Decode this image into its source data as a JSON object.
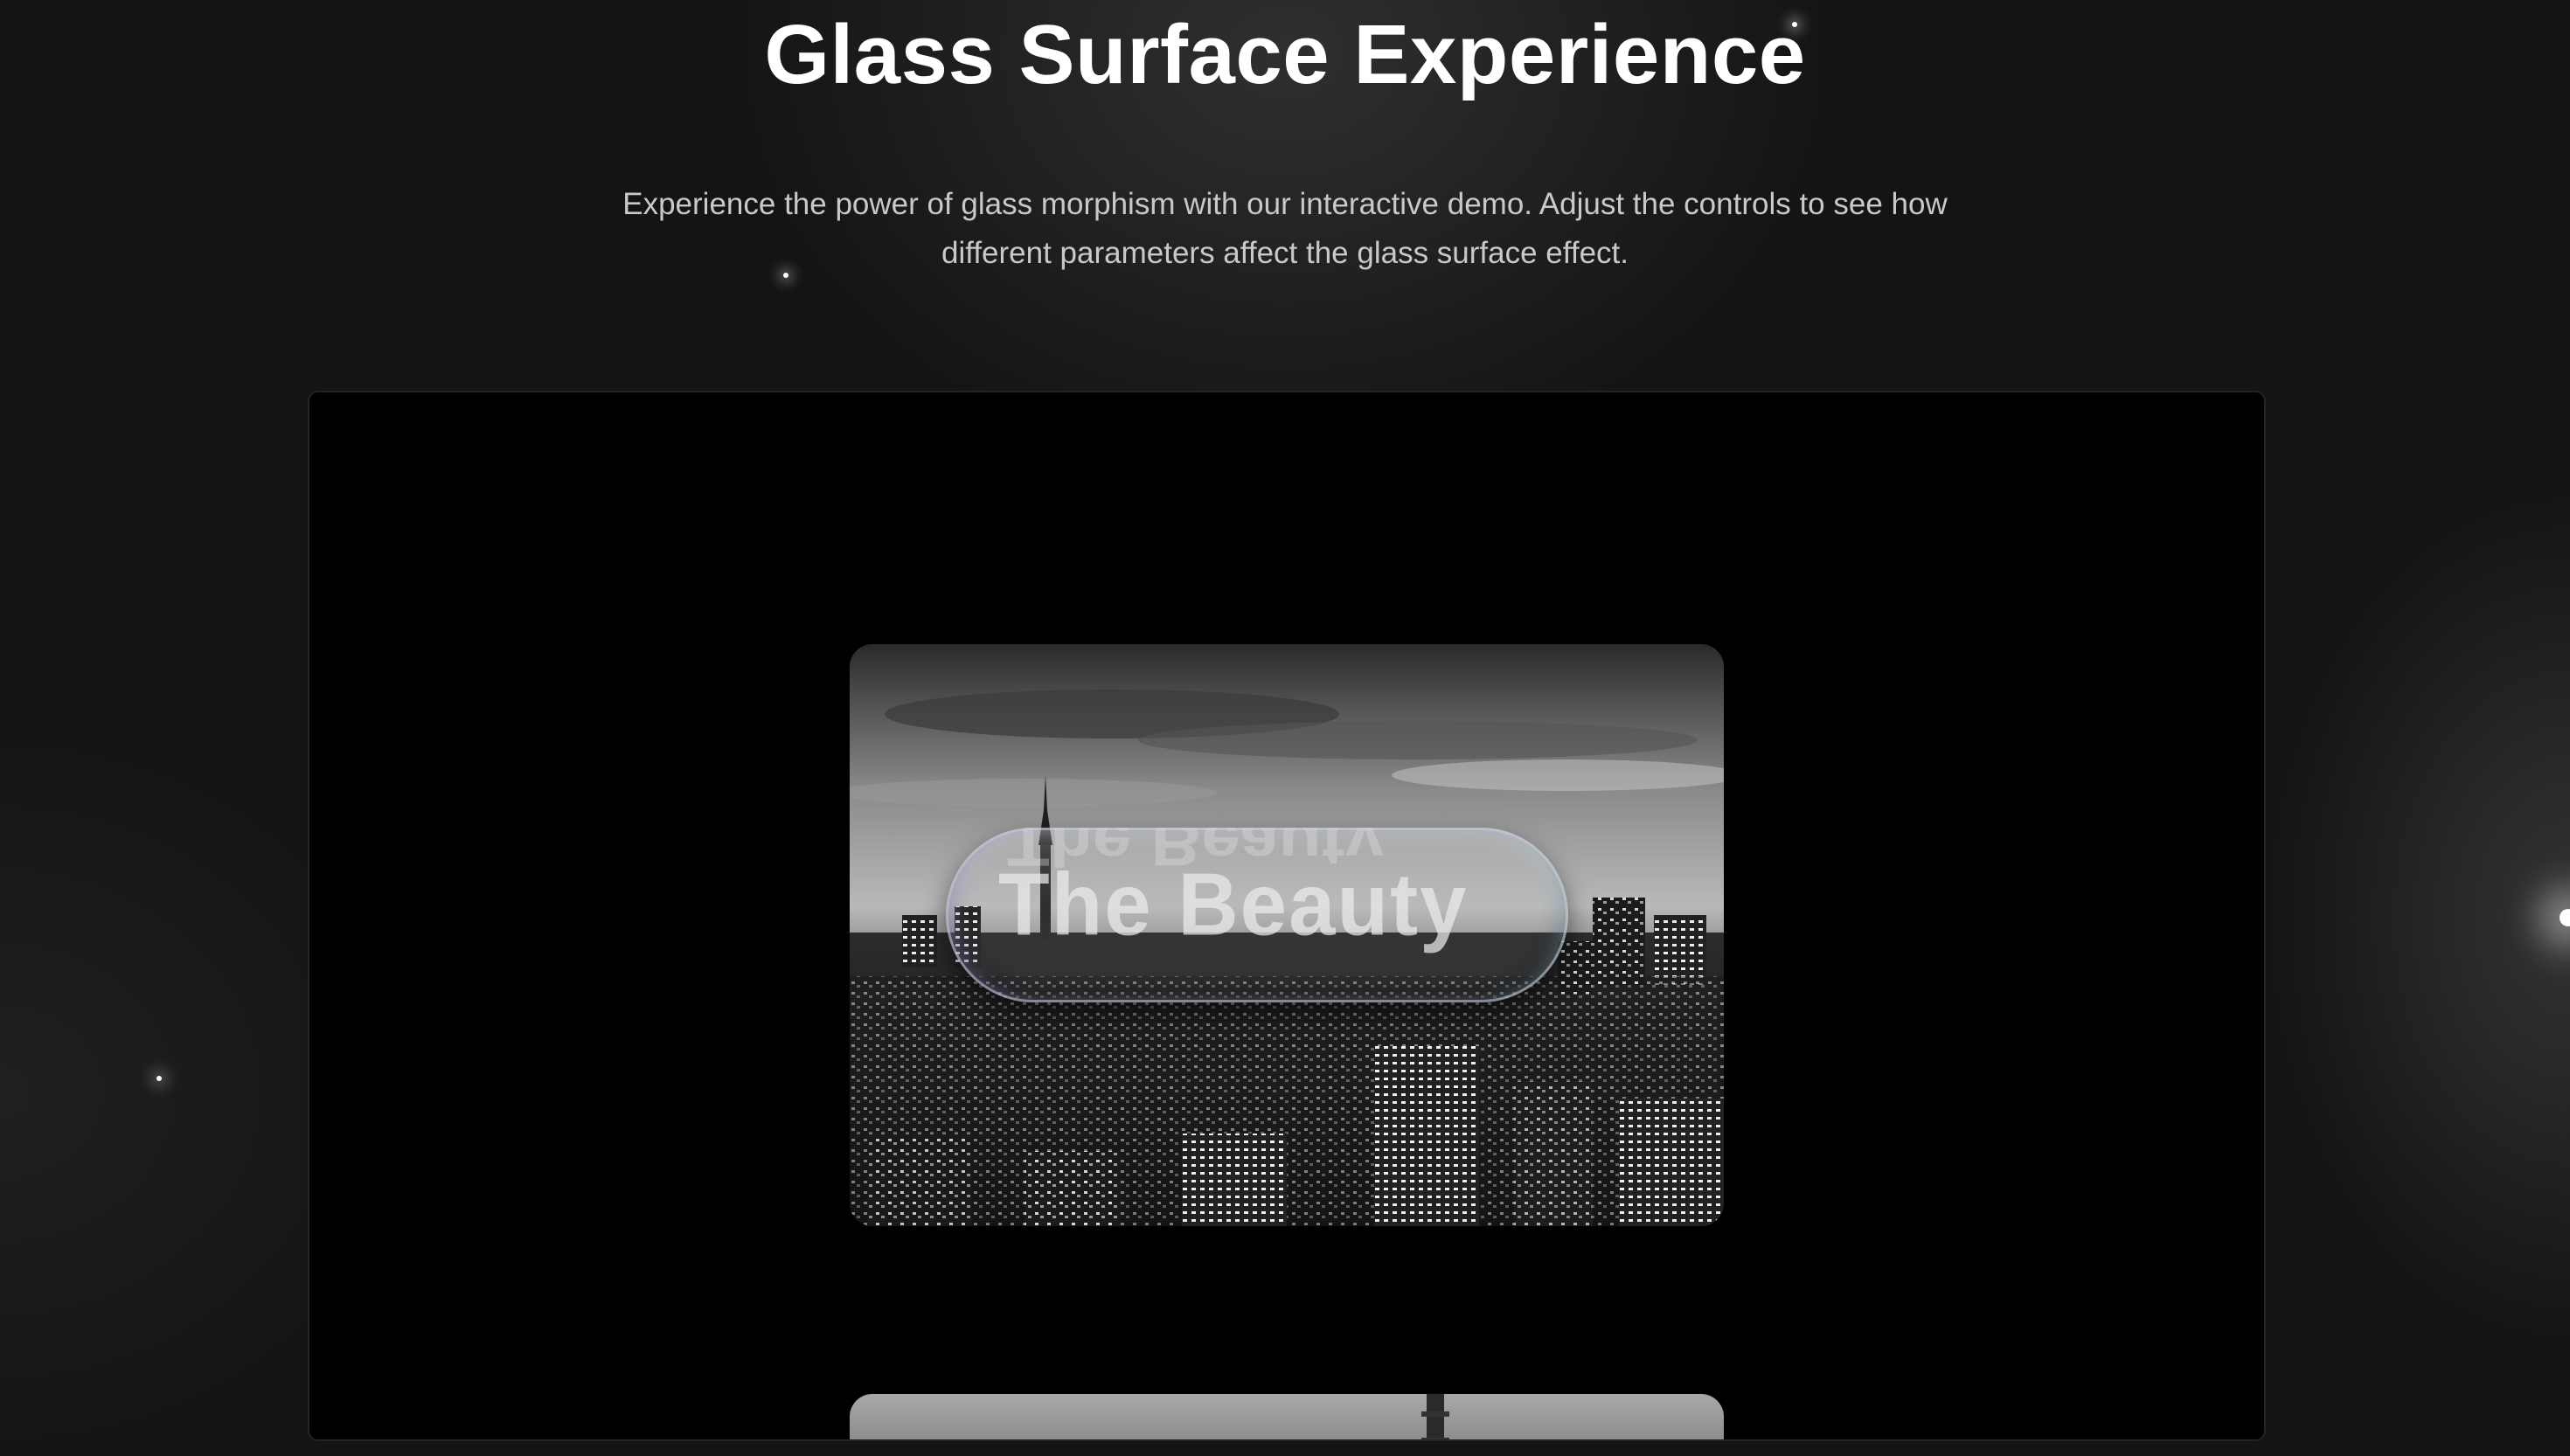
{
  "header": {
    "title": "Glass Surface Experience",
    "description": "Experience the power of glass morphism with our interactive demo. Adjust the controls to see how different parameters affect the glass surface effect."
  },
  "demo": {
    "glass_text": "The Beauty",
    "images": [
      {
        "name": "city-skyline-night",
        "style": "grayscale"
      },
      {
        "name": "tower-sky",
        "style": "grayscale"
      }
    ]
  },
  "colors": {
    "page_background": "#141414",
    "stage_background": "#000000",
    "title": "#ffffff",
    "subtitle": "#c9c9c9"
  }
}
